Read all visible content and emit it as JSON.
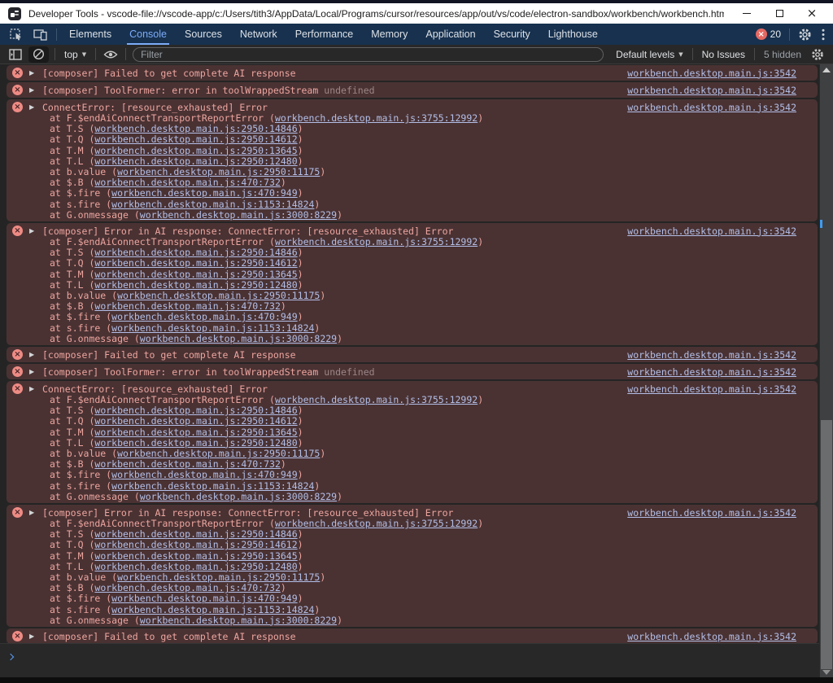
{
  "window": {
    "title": "Developer Tools - vscode-file://vscode-app/c:/Users/tith3/AppData/Local/Programs/cursor/resources/app/out/vs/code/electron-sandbox/workbench/workbench.html"
  },
  "tabbar": {
    "tabs": [
      {
        "label": "Elements"
      },
      {
        "label": "Console"
      },
      {
        "label": "Sources"
      },
      {
        "label": "Network"
      },
      {
        "label": "Performance"
      },
      {
        "label": "Memory"
      },
      {
        "label": "Application"
      },
      {
        "label": "Security"
      },
      {
        "label": "Lighthouse"
      }
    ],
    "active_tab": "Console",
    "error_count": "20"
  },
  "toolbar": {
    "context_selector": "top",
    "filter_placeholder": "Filter",
    "filter_value": "",
    "levels_label": "Default levels",
    "issues_label": "No Issues",
    "hidden_label": "5 hidden"
  },
  "console": {
    "source_link": "workbench.desktop.main.js:3542",
    "stack_frames": [
      {
        "fn": "at F.$endAiConnectTransportReportError",
        "link": "workbench.desktop.main.js:3755:12992"
      },
      {
        "fn": "at T.S",
        "link": "workbench.desktop.main.js:2950:14846"
      },
      {
        "fn": "at T.Q",
        "link": "workbench.desktop.main.js:2950:14612"
      },
      {
        "fn": "at T.M",
        "link": "workbench.desktop.main.js:2950:13645"
      },
      {
        "fn": "at T.L",
        "link": "workbench.desktop.main.js:2950:12480"
      },
      {
        "fn": "at b.value",
        "link": "workbench.desktop.main.js:2950:11175"
      },
      {
        "fn": "at $.B",
        "link": "workbench.desktop.main.js:470:732"
      },
      {
        "fn": "at $.fire",
        "link": "workbench.desktop.main.js:470:949"
      },
      {
        "fn": "at s.fire",
        "link": "workbench.desktop.main.js:1153:14824"
      },
      {
        "fn": "at G.onmessage",
        "link": "workbench.desktop.main.js:3000:8229"
      }
    ],
    "messages": [
      {
        "kind": "simple",
        "text": "[composer] Failed to get complete AI response"
      },
      {
        "kind": "simple",
        "text": "[composer] ToolFormer: error in toolWrappedStream",
        "muted": "undefined"
      },
      {
        "kind": "stack",
        "text": "ConnectError: [resource_exhausted] Error"
      },
      {
        "kind": "stack",
        "text": "[composer] Error in AI response: ConnectError: [resource_exhausted] Error"
      },
      {
        "kind": "simple",
        "text": "[composer] Failed to get complete AI response"
      },
      {
        "kind": "simple",
        "text": "[composer] ToolFormer: error in toolWrappedStream",
        "muted": "undefined"
      },
      {
        "kind": "stack",
        "text": "ConnectError: [resource_exhausted] Error"
      },
      {
        "kind": "stack",
        "text": "[composer] Error in AI response: ConnectError: [resource_exhausted] Error"
      },
      {
        "kind": "simple",
        "text": "[composer] Failed to get complete AI response"
      }
    ]
  },
  "colors": {
    "tabbar_bg": "#17314f",
    "accent": "#7cacf8",
    "error_row_bg": "#4a3233",
    "error_text": "#eda59f",
    "error_icon": "#ee8b84",
    "link": "#b3bfe8",
    "badge": "#e46962",
    "titlebar_bg": "#ffffff"
  }
}
